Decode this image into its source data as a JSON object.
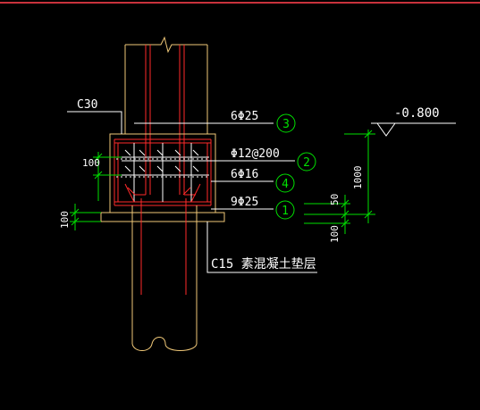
{
  "colors": {
    "background": "#000000",
    "top_border": "#c8323c",
    "outline": "#f0c878",
    "rebar": "#ff2a2a",
    "stirrup": "#ffffff",
    "dimension": "#00e000",
    "text": "#ffffff"
  },
  "labels": {
    "concrete_grade": "C30",
    "elevation": "-0.800",
    "bedding_note": "C15 素混凝土垫层"
  },
  "rebar_callouts": [
    {
      "number": "3",
      "spec": "6Φ25"
    },
    {
      "number": "2",
      "spec": "Φ12@200"
    },
    {
      "number": "4",
      "spec": "6Φ16"
    },
    {
      "number": "1",
      "spec": "9Φ25"
    }
  ],
  "dimensions": {
    "left_cover": "100",
    "bedding_thickness_left": "100",
    "right_total_height": "1000",
    "right_cover": "50",
    "right_bedding": "100"
  }
}
